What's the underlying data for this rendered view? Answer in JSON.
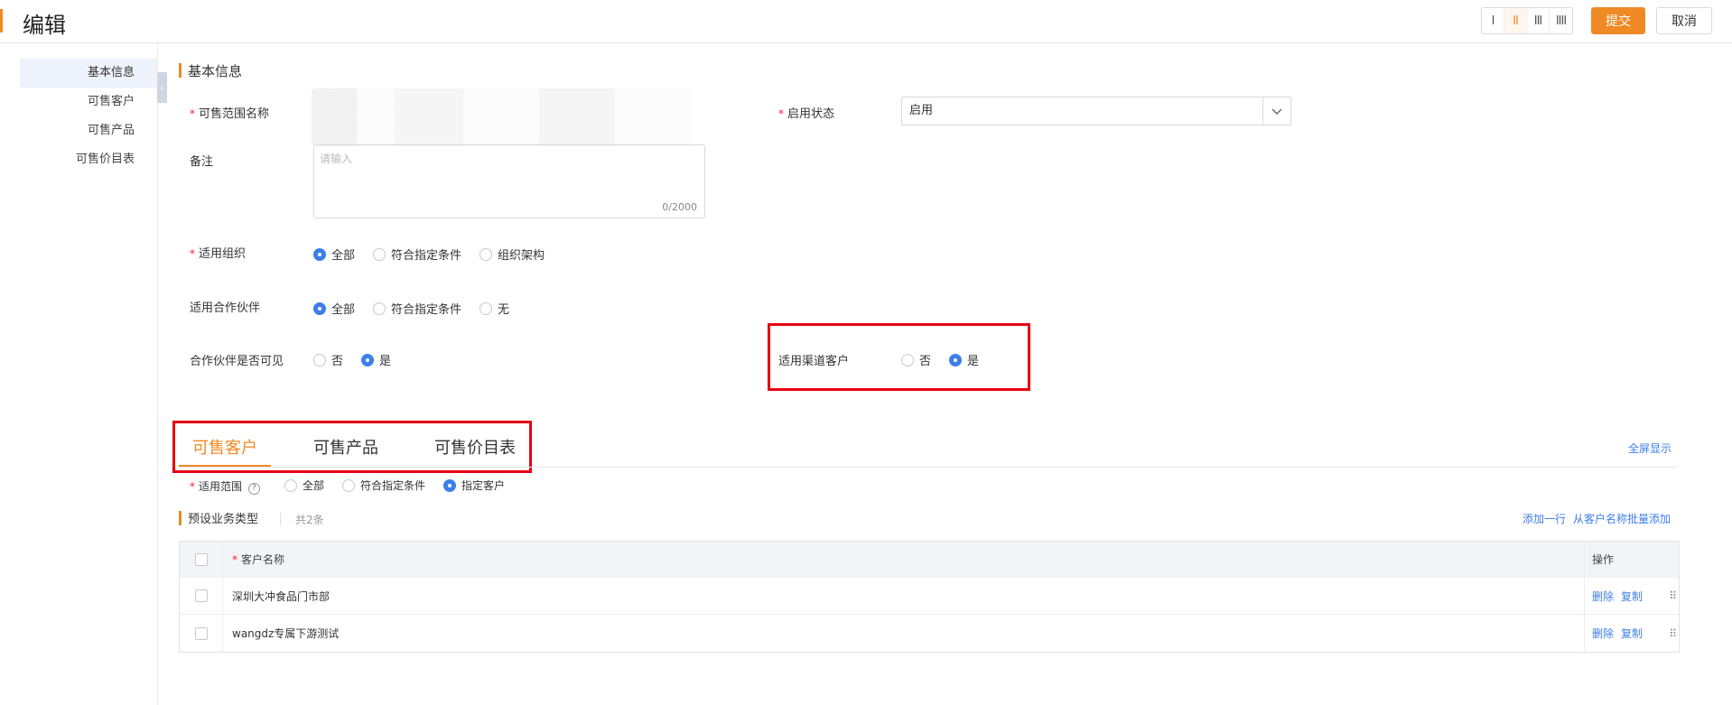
{
  "header": {
    "title": "编辑",
    "layout_options": [
      "I",
      "II",
      "III",
      "IIII"
    ],
    "submit_label": "提交",
    "cancel_label": "取消"
  },
  "sidebar": {
    "items": [
      {
        "label": "基本信息",
        "active": true
      },
      {
        "label": "可售客户",
        "active": false
      },
      {
        "label": "可售产品",
        "active": false
      },
      {
        "label": "可售价目表",
        "active": false
      }
    ],
    "collapse_glyph": "‹"
  },
  "basic": {
    "section_title": "基本信息",
    "required_mark": "*",
    "name_label": "可售范围名称",
    "status_label": "启用状态",
    "status_value": "启用",
    "remark_label": "备注",
    "remark_placeholder": "请输入",
    "remark_count": "0/2000",
    "org_label": "适用组织",
    "org_options": [
      "全部",
      "符合指定条件",
      "组织架构"
    ],
    "partner_label": "适用合作伙伴",
    "partner_options": [
      "全部",
      "符合指定条件",
      "无"
    ],
    "partner_visible_label": "合作伙伴是否可见",
    "partner_visible_options": [
      "否",
      "是"
    ],
    "channel_label": "适用渠道客户",
    "channel_options": [
      "否",
      "是"
    ]
  },
  "tabs": [
    "可售客户",
    "可售产品",
    "可售价目表"
  ],
  "fullscreen_label": "全屏显示",
  "scope": {
    "label": "适用范围",
    "help_icon": "?",
    "options": [
      "全部",
      "符合指定条件",
      "指定客户"
    ]
  },
  "preset": {
    "title": "预设业务类型",
    "count": "共2条",
    "add_row": "添加一行",
    "batch_add": "从客户名称批量添加"
  },
  "table": {
    "col_name": "客户名称",
    "col_op": "操作",
    "op_delete": "删除",
    "op_copy": "复制",
    "drag_glyph": "⠿",
    "rows": [
      {
        "name": "深圳大冲食品门市部"
      },
      {
        "name": "wangdz专属下游测试"
      }
    ]
  },
  "colors": {
    "accent": "#f08a24",
    "link": "#3d7eea",
    "highlight_box": "#e60012"
  }
}
